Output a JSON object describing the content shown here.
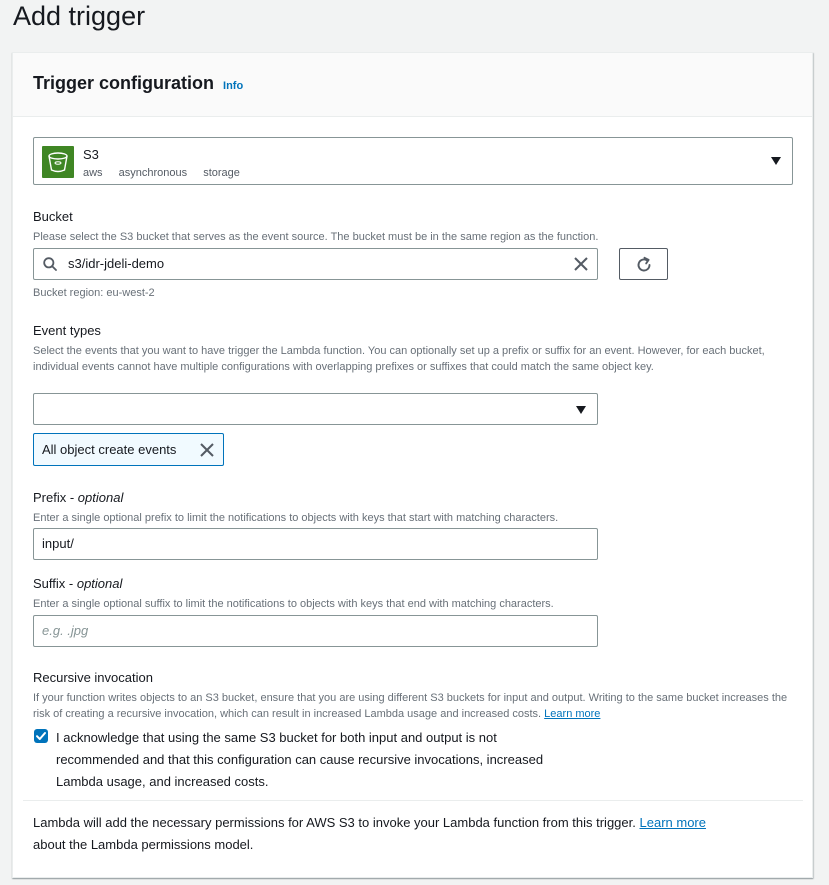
{
  "page": {
    "title": "Add trigger"
  },
  "panel": {
    "title": "Trigger configuration",
    "info_label": "Info"
  },
  "service": {
    "name": "S3",
    "tags": [
      "aws",
      "asynchronous",
      "storage"
    ],
    "icon": "s3-bucket-icon",
    "icon_color": "#3f8624"
  },
  "bucket": {
    "label": "Bucket",
    "description": "Please select the S3 bucket that serves as the event source. The bucket must be in the same region as the function.",
    "value": "s3/idr-jdeli-demo",
    "region_text": "Bucket region: eu-west-2"
  },
  "event_types": {
    "label": "Event types",
    "description": "Select the events that you want to have trigger the Lambda function. You can optionally set up a prefix or suffix for an event. However, for each bucket, individual events cannot have multiple configurations with overlapping prefixes or suffixes that could match the same object key.",
    "selected_value": "",
    "tokens": [
      "All object create events"
    ]
  },
  "prefix": {
    "label": "Prefix - ",
    "label_optional": "optional",
    "description": "Enter a single optional prefix to limit the notifications to objects with keys that start with matching characters.",
    "value": "input/"
  },
  "suffix": {
    "label": "Suffix - ",
    "label_optional": "optional",
    "description": "Enter a single optional suffix to limit the notifications to objects with keys that end with matching characters.",
    "placeholder": "e.g. .jpg"
  },
  "recursive": {
    "label": "Recursive invocation",
    "description": "If your function writes objects to an S3 bucket, ensure that you are using different S3 buckets for input and output. Writing to the same bucket increases the risk of creating a recursive invocation, which can result in increased Lambda usage and increased costs.",
    "learn_more": "Learn more",
    "ack_line1": "I acknowledge that using the same S3 bucket for both input and output is not",
    "ack_line2": "recommended and that this configuration can cause recursive invocations, increased",
    "ack_line3": "Lambda usage, and increased costs.",
    "checked": true
  },
  "footer": {
    "text_part1": "Lambda will add the necessary permissions for AWS S3 to invoke your Lambda function from this trigger.",
    "learn_more": "Learn more",
    "text_part2": "about the Lambda permissions model."
  },
  "colors": {
    "accent": "#0073bb",
    "service_green": "#3f8624"
  }
}
